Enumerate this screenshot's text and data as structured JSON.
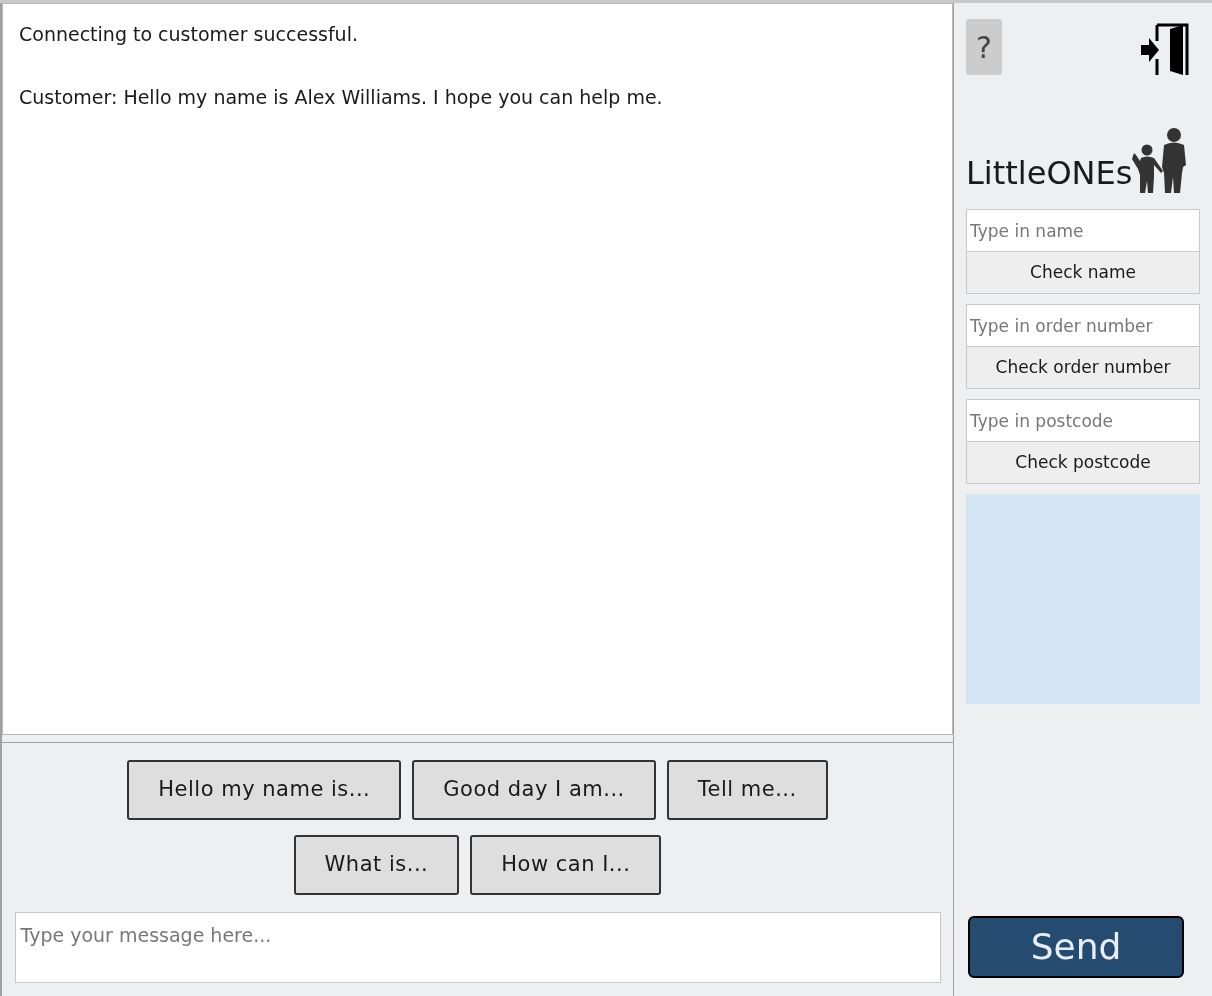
{
  "chat": {
    "messages": [
      "Connecting to customer successful.",
      "Customer: Hello my name is Alex Williams. I hope you can help me."
    ]
  },
  "quick_replies": [
    [
      "Hello my name is...",
      "Good day I am...",
      "Tell me..."
    ],
    [
      "What is...",
      "How can I..."
    ]
  ],
  "message_input": {
    "placeholder": "Type your message here..."
  },
  "sidebar": {
    "help_button": "?",
    "logo": "LittleONEs",
    "checks": [
      {
        "placeholder": "Type in name",
        "button": "Check name"
      },
      {
        "placeholder": "Type in order number",
        "button": "Check order number"
      },
      {
        "placeholder": "Type in postcode",
        "button": "Check postcode"
      }
    ],
    "send_button": "Send"
  }
}
